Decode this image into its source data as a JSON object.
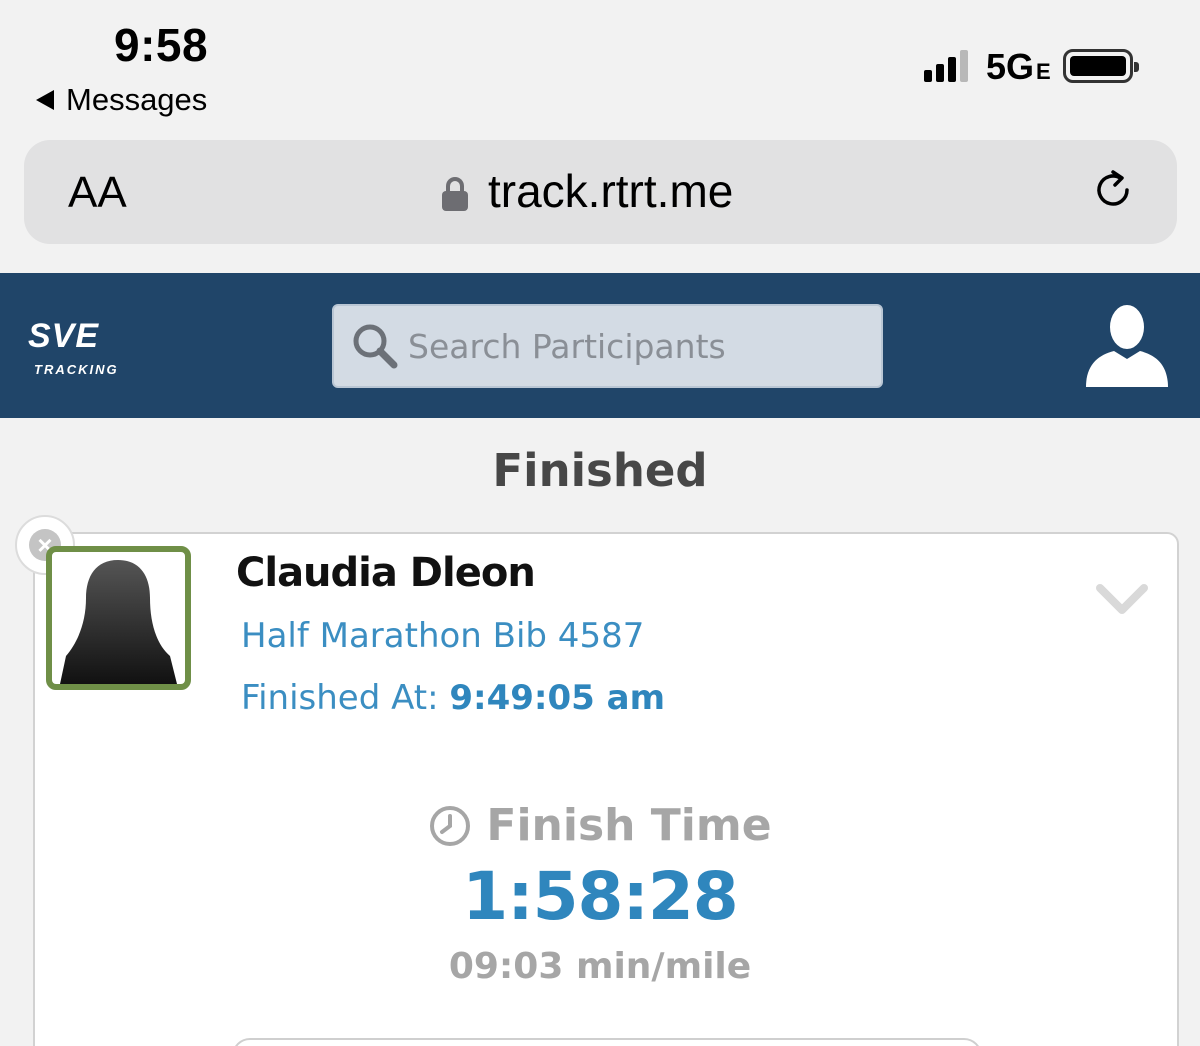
{
  "status_bar": {
    "time": "9:58",
    "back_label": "Messages",
    "network": "5G",
    "network_suffix": "E"
  },
  "address_bar": {
    "text_size_label": "AA",
    "url": "track.rtrt.me"
  },
  "header": {
    "logo_text": "SVE",
    "logo_sub": "TRACKING",
    "search_placeholder": "Search Participants"
  },
  "section": {
    "title": "Finished"
  },
  "participant": {
    "name": "Claudia Dleon",
    "race_bib": "Half Marathon Bib 4587",
    "finished_at_label": "Finished At:",
    "finished_at_value": "9:49:05 am",
    "finish_time_label": "Finish Time",
    "finish_time": "1:58:28",
    "pace": "09:03 min/mile"
  },
  "colors": {
    "header_bg": "#204569",
    "link_blue": "#2f86bd",
    "avatar_border": "#6f8f47"
  }
}
